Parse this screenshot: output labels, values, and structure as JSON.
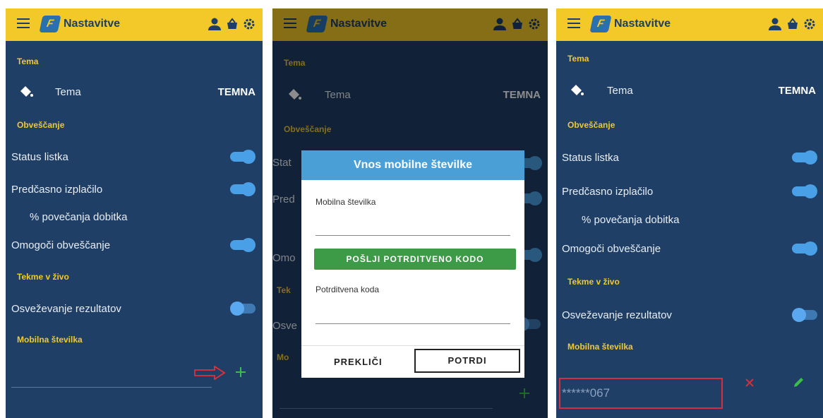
{
  "header": {
    "title": "Nastavitve",
    "logo_text": "F"
  },
  "sections": {
    "tema": "Tema",
    "obvescanje": "Obveščanje",
    "tekme": "Tekme v živo",
    "mobilna": "Mobilna številka"
  },
  "rows": {
    "tema_label": "Tema",
    "tema_value": "TEMNA",
    "status": "Status listka",
    "predcasno": "Predčasno izplačilo",
    "povecanja": "% povečanja dobitka",
    "omogoci": "Omogoči obveščanje",
    "osvezevanje": "Osveževanje rezultatov"
  },
  "toggles": {
    "status": true,
    "predcasno": true,
    "omogoci": true,
    "osvezevanje": false
  },
  "dialog": {
    "title": "Vnos mobilne številke",
    "mobile_label": "Mobilna številka",
    "send_button": "POŠLJI POTRDITVENO KODO",
    "code_label": "Potrditvena koda",
    "cancel": "PREKLIČI",
    "confirm": "POTRDI"
  },
  "partial_dialog_bg": {
    "stat": "Stat",
    "pred": "Pred",
    "omo": "Omo",
    "tek": "Tek",
    "osve": "Osve",
    "mo": "Mo"
  },
  "mobile": {
    "masked_number": "******067"
  },
  "icons": [
    "menu-icon",
    "user-icon",
    "shop-icon",
    "settings-icon",
    "paint-bucket-icon",
    "add-icon",
    "delete-icon",
    "edit-icon",
    "arrow-icon"
  ],
  "colors": {
    "background": "#1f3f66",
    "header": "#f2c928",
    "section": "#f2c928",
    "toggle_on": "#4aa0e6",
    "dialog_header": "#4a9fd6",
    "send_button": "#3d9a46",
    "delete": "#d32f3c",
    "add": "#3bbd4a"
  }
}
